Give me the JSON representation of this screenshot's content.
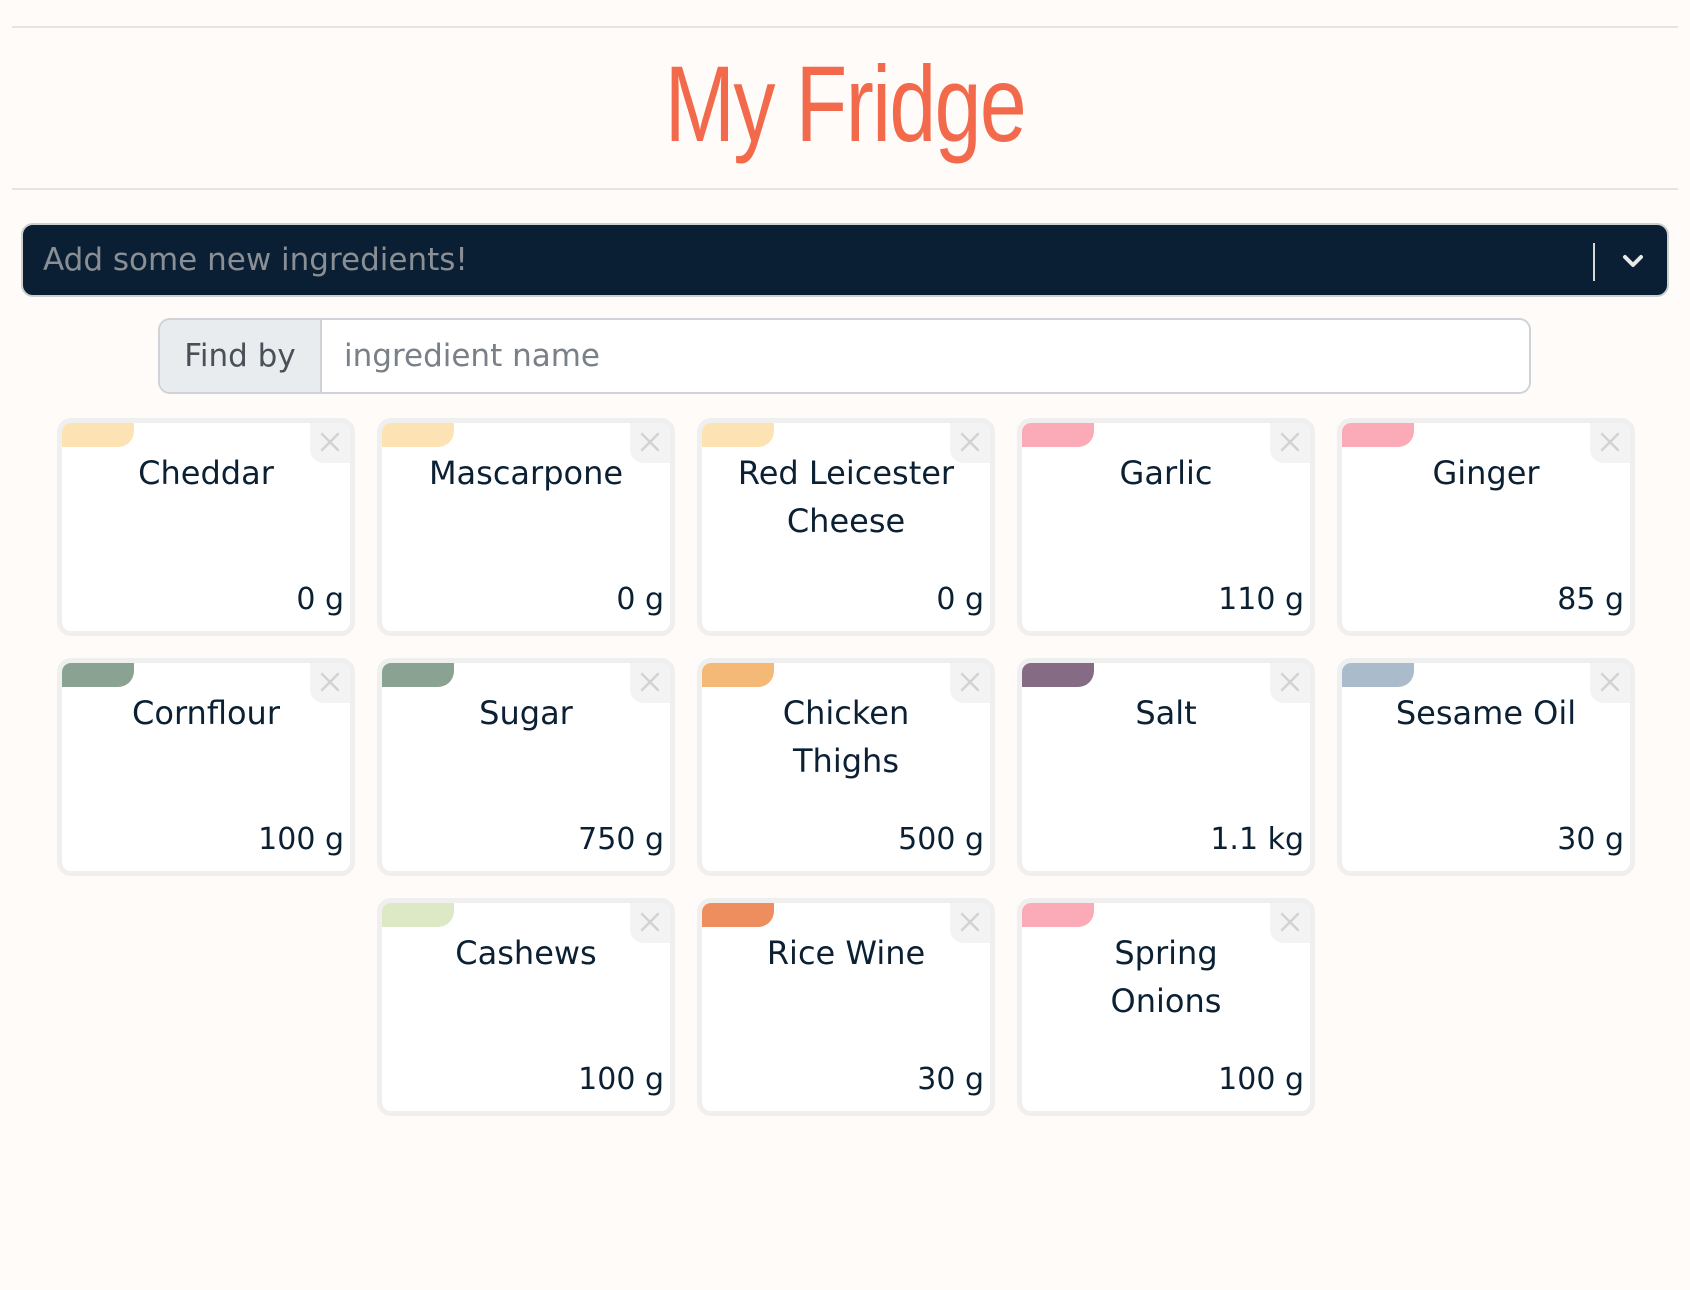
{
  "header": {
    "title": "My Fridge"
  },
  "add_bar": {
    "placeholder": "Add some new ingredients!"
  },
  "search": {
    "label": "Find by",
    "placeholder": "ingredient name"
  },
  "ingredients": [
    {
      "name": "Cheddar",
      "quantity": "0 g",
      "tag_color": "#fde3b3"
    },
    {
      "name": "Mascarpone",
      "quantity": "0 g",
      "tag_color": "#fde3b3"
    },
    {
      "name": "Red Leicester Cheese",
      "quantity": "0 g",
      "tag_color": "#fde3b3"
    },
    {
      "name": "Garlic",
      "quantity": "110 g",
      "tag_color": "#fbaab7"
    },
    {
      "name": "Ginger",
      "quantity": "85 g",
      "tag_color": "#fbaab7"
    },
    {
      "name": "Cornflour",
      "quantity": "100 g",
      "tag_color": "#89a292"
    },
    {
      "name": "Sugar",
      "quantity": "750 g",
      "tag_color": "#89a292"
    },
    {
      "name": "Chicken Thighs",
      "quantity": "500 g",
      "tag_color": "#f4b877"
    },
    {
      "name": "Salt",
      "quantity": "1.1 kg",
      "tag_color": "#866b84"
    },
    {
      "name": "Sesame Oil",
      "quantity": "30 g",
      "tag_color": "#aabccc"
    },
    {
      "name": "Cashews",
      "quantity": "100 g",
      "tag_color": "#dde9c4"
    },
    {
      "name": "Rice Wine",
      "quantity": "30 g",
      "tag_color": "#ee8e5e"
    },
    {
      "name": "Spring Onions",
      "quantity": "100 g",
      "tag_color": "#fbaab7"
    }
  ]
}
